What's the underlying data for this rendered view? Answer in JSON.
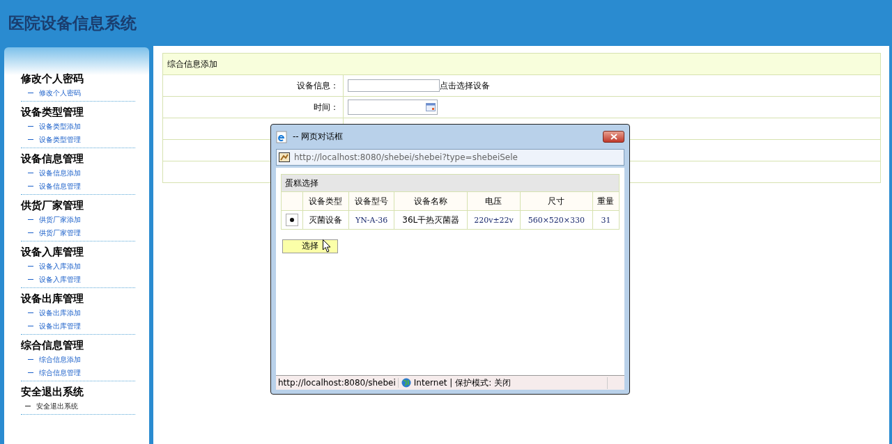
{
  "header": {
    "title": "医院设备信息系统"
  },
  "sidebar": {
    "groups": [
      {
        "title": "修改个人密码",
        "items": [
          {
            "label": "修改个人密码",
            "kind": "link"
          }
        ]
      },
      {
        "title": "设备类型管理",
        "items": [
          {
            "label": "设备类型添加",
            "kind": "link"
          },
          {
            "label": "设备类型管理",
            "kind": "link"
          }
        ]
      },
      {
        "title": "设备信息管理",
        "items": [
          {
            "label": "设备信息添加",
            "kind": "link"
          },
          {
            "label": "设备信息管理",
            "kind": "link"
          }
        ]
      },
      {
        "title": "供货厂家管理",
        "items": [
          {
            "label": "供货厂家添加",
            "kind": "link"
          },
          {
            "label": "供货厂家管理",
            "kind": "link"
          }
        ]
      },
      {
        "title": "设备入库管理",
        "items": [
          {
            "label": "设备入库添加",
            "kind": "link"
          },
          {
            "label": "设备入库管理",
            "kind": "link"
          }
        ]
      },
      {
        "title": "设备出库管理",
        "items": [
          {
            "label": "设备出库添加",
            "kind": "link"
          },
          {
            "label": "设备出库管理",
            "kind": "link"
          }
        ]
      },
      {
        "title": "综合信息管理",
        "items": [
          {
            "label": "综合信息添加",
            "kind": "link"
          },
          {
            "label": "综合信息管理",
            "kind": "link"
          }
        ]
      },
      {
        "title": "安全退出系统",
        "items": [
          {
            "label": "安全退出系统",
            "kind": "exit"
          }
        ]
      }
    ]
  },
  "form": {
    "title": "综合信息添加",
    "rows": [
      {
        "kind": "select",
        "label": "设备信息：",
        "link": "点击选择设备"
      },
      {
        "kind": "date",
        "label": "时间："
      },
      {
        "kind": "empty"
      },
      {
        "kind": "empty"
      },
      {
        "kind": "empty"
      }
    ]
  },
  "dialog": {
    "title": "-- 网页对话框",
    "address": "http://localhost:8080/shebei/shebei?type=shebeiSele",
    "table": {
      "title": "蛋糕选择",
      "columns": [
        "设备类型",
        "设备型号",
        "设备名称",
        "电压",
        "尺寸",
        "重量"
      ],
      "rows": [
        {
          "selected": true,
          "cells": [
            "灭菌设备",
            "YN-A-36",
            "36L干热灭菌器",
            "220v±22v",
            "560×520×330",
            "31"
          ]
        }
      ]
    },
    "button": "选择",
    "status_bar": {
      "url": "http://localhost:8080/shebei",
      "zone": "Internet | 保护模式: 关闭"
    }
  }
}
